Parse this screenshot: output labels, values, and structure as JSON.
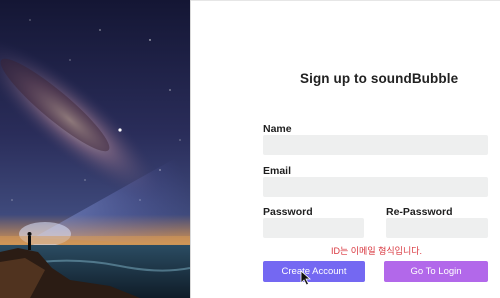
{
  "form": {
    "title": "Sign up to soundBubble",
    "name_label": "Name",
    "name_value": "",
    "name_placeholder": "",
    "email_label": "Email",
    "email_value": "",
    "email_placeholder": "",
    "password_label": "Password",
    "password_value": "",
    "repassword_label": "Re-Password",
    "repassword_value": "",
    "error_message": "ID는 이메일 형식입니다.",
    "create_button": "Create Account",
    "login_button": "Go To Login"
  },
  "colors": {
    "primary": "#7468f2",
    "secondary": "#b268ea",
    "error": "#d9363e",
    "field_bg": "#eeefef"
  },
  "icons": {
    "cursor": "mouse-pointer-icon",
    "hero": "milky-way-night-sky-photo"
  }
}
